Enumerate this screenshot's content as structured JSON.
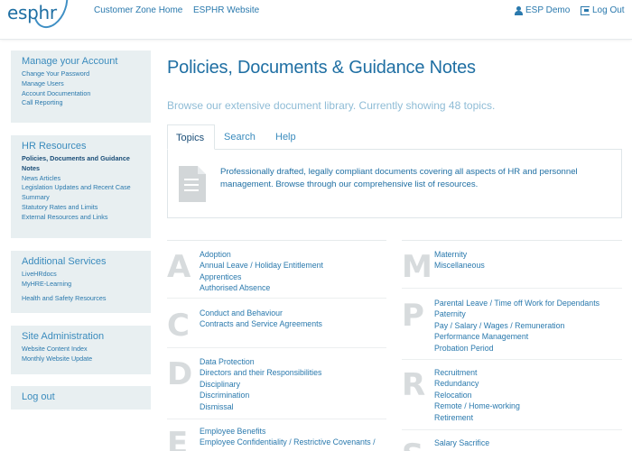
{
  "header": {
    "logo_text": "esphr",
    "nav": [
      "Customer Zone Home",
      "ESPHR Website"
    ],
    "user_label": "ESP Demo",
    "logout_label": "Log Out"
  },
  "sidebar": {
    "account": {
      "title": "Manage your Account",
      "items": [
        "Change Your Password",
        "Manage Users",
        "Account Documentation",
        "Call Reporting"
      ]
    },
    "hr": {
      "title": "HR Resources",
      "items": [
        "Policies, Documents and Guidance",
        "Notes",
        "News Articles",
        "Legislation Updates and Recent Case",
        "Summary",
        "Statutory Rates and Limits",
        "External Resources and Links"
      ]
    },
    "additional": {
      "title": "Additional Services",
      "items": [
        "LiveHRdocs",
        "MyHRE-Learning",
        "Health and Safety Resources"
      ]
    },
    "site": {
      "title": "Site Administration",
      "items": [
        "Website Content Index",
        "Monthly Website Update"
      ]
    },
    "logout": "Log out"
  },
  "main": {
    "title": "Policies, Documents & Guidance Notes",
    "subtitle": "Browse our extensive document library. Currently showing 48 topics.",
    "tabs": [
      "Topics",
      "Search",
      "Help"
    ],
    "intro": "Professionally drafted, legally compliant documents covering all aspects of HR and personnel management. Browse through our comprehensive list of resources."
  },
  "topics": {
    "left": [
      {
        "letter": "A",
        "items": [
          "Adoption",
          "Annual Leave / Holiday Entitlement",
          "Apprentices",
          "Authorised Absence"
        ]
      },
      {
        "letter": "C",
        "items": [
          "Conduct and Behaviour",
          "Contracts and Service Agreements"
        ]
      },
      {
        "letter": "D",
        "items": [
          "Data Protection",
          "Directors and their Responsibilities",
          "Disciplinary",
          "Discrimination",
          "Dismissal"
        ]
      },
      {
        "letter": "E",
        "items": [
          "Employee Benefits",
          "Employee Confidentiality / Restrictive Covenants /"
        ]
      }
    ],
    "right": [
      {
        "letter": "M",
        "items": [
          "Maternity",
          "Miscellaneous"
        ]
      },
      {
        "letter": "P",
        "items": [
          "Parental Leave / Time off Work for Dependants",
          "Paternity",
          "Pay / Salary / Wages / Remuneration",
          "Performance Management",
          "Probation Period"
        ]
      },
      {
        "letter": "R",
        "items": [
          "Recruitment",
          "Redundancy",
          "Relocation",
          "Remote / Home-working",
          "Retirement"
        ]
      },
      {
        "letter": "S",
        "items": [
          "Salary Sacrifice"
        ]
      }
    ]
  }
}
